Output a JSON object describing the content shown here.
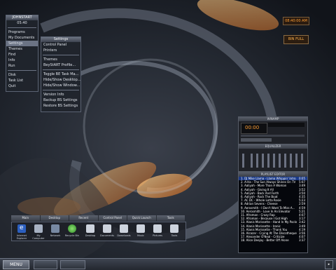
{
  "start_menu": {
    "title": "JOHNSTART",
    "time": "05:40",
    "items": [
      {
        "label": "Programs"
      },
      {
        "label": "My Documents"
      },
      {
        "label": "Settings"
      },
      {
        "label": "Themes"
      },
      {
        "label": "Find"
      },
      {
        "label": "Info"
      },
      {
        "label": "Run"
      },
      {
        "label": "Disk"
      },
      {
        "label": "Task List"
      },
      {
        "label": "Quit"
      }
    ]
  },
  "settings_menu": {
    "title": "Settings",
    "items": [
      {
        "label": "Control Panel"
      },
      {
        "label": "Printers"
      },
      {
        "label": "Themes"
      },
      {
        "label": "BeyStART Profile..."
      },
      {
        "label": "Toggle BE Task Ma..."
      },
      {
        "label": "Hide/Show Desktop..."
      },
      {
        "label": "Hide/Show Window..."
      },
      {
        "label": "Version Info"
      },
      {
        "label": "Backup BS Settings"
      },
      {
        "label": "Restore BS Settings"
      }
    ]
  },
  "clock": {
    "time": "08:40:00 AM"
  },
  "widget": {
    "label": "BIN FULL"
  },
  "launch_bar": {
    "tabs": [
      "Main",
      "Desktop",
      "Recent",
      "Control Panel",
      "Quick Launch",
      "Tools"
    ],
    "icons": [
      {
        "name": "internet-explorer",
        "label": "Internet Explorer"
      },
      {
        "name": "my-computer",
        "label": "My Computer"
      },
      {
        "name": "network",
        "label": "Network"
      },
      {
        "name": "recycle-bin",
        "label": "Recycle Bin"
      },
      {
        "name": "folder",
        "label": "Desktop"
      },
      {
        "name": "folder",
        "label": "Documents"
      },
      {
        "name": "folder",
        "label": "Downloads"
      },
      {
        "name": "folder",
        "label": "Music"
      },
      {
        "name": "folder",
        "label": "Pictures"
      },
      {
        "name": "folder",
        "label": "Tools"
      }
    ]
  },
  "taskbar": {
    "menu_label": "MENU"
  },
  "winamp": {
    "main_title": "WINAMP",
    "time": "00:00",
    "eq_title": "EQUALIZER",
    "pl_title": "PLAYLIST EDITOR",
    "playlist": [
      {
        "title": "1. DJ Mike Llama - Llama Whippin' Intro",
        "time": "0:05"
      },
      {
        "title": "2. A-Ha - The Sun Always Shines On TV",
        "time": "5:07"
      },
      {
        "title": "3. Aaliyah - More Than A Woman",
        "time": "3:49"
      },
      {
        "title": "4. Aaliyah - Giving It All",
        "time": "3:52"
      },
      {
        "title": "5. Aaliyah - Back And Forth",
        "time": "3:50"
      },
      {
        "title": "6. Aaliyah - Rock The Boat",
        "time": "4:35"
      },
      {
        "title": "7. AC DC - Whole Lotta Rosie",
        "time": "5:23"
      },
      {
        "title": "8. Adrian Sevens - Cheese",
        "time": "2:59"
      },
      {
        "title": "9. Aerosmith - I Don't Want To Miss A...",
        "time": "4:59"
      },
      {
        "title": "10. Aerosmith - Love In An Elevator",
        "time": "5:21"
      },
      {
        "title": "11. Afroman - Crazy Rap",
        "time": "4:07"
      },
      {
        "title": "12. Afroman - Because I Got High",
        "time": "3:17"
      },
      {
        "title": "13. Alanis Morissette - Hand In My Pocket",
        "time": "3:42"
      },
      {
        "title": "14. Alanis Morissette - Ironic",
        "time": "3:49"
      },
      {
        "title": "15. Alanis Morissette - Thank You",
        "time": "4:19"
      },
      {
        "title": "16. Alcazar - Crying At The Discotheque",
        "time": "3:56"
      },
      {
        "title": "17. Alexander O'Neal - Criticize",
        "time": "4:07"
      },
      {
        "title": "18. Alice Deejay - Better Off Alone",
        "time": "3:37"
      }
    ]
  },
  "colors": {
    "accent": "#ff9e33",
    "menu_highlight": "#6b7384",
    "playlist_select": "#1a3a8a"
  }
}
